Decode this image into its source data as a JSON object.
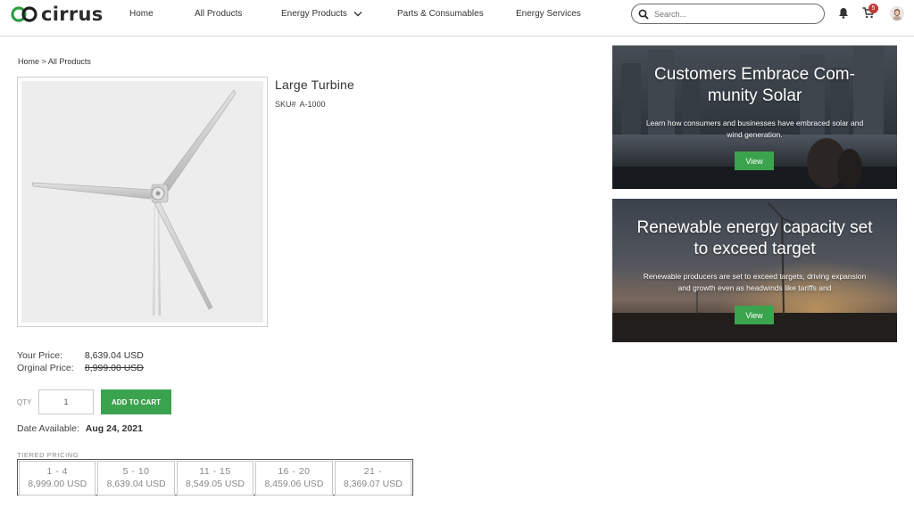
{
  "brand": {
    "name": "cirrus",
    "color": "#2e9e45"
  },
  "nav": {
    "items": [
      {
        "label": "Home"
      },
      {
        "label": "All Products"
      },
      {
        "label": "Energy Products"
      },
      {
        "label": "Parts & Consumables"
      },
      {
        "label": "Energy Services"
      }
    ],
    "search_placeholder": "Search...",
    "cart_count": "5"
  },
  "breadcrumb": {
    "home": "Home",
    "separator": ">",
    "current": "All Products"
  },
  "product": {
    "title": "Large Turbine",
    "sku_label": "SKU#",
    "sku": "A-1000",
    "your_price_label": "Your Price:",
    "your_price": "8,639.04 USD",
    "original_price_label": "Orginal Price:",
    "original_price": "8,999.00 USD",
    "qty_label": "QTY",
    "qty_value": "1",
    "add_to_cart": "ADD TO CART",
    "date_label": "Date Available:",
    "date_value": "Aug 24, 2021",
    "tier_title": "TIERED PRICING",
    "tiers": [
      {
        "range": "1 - 4",
        "price": "8,999.00 USD"
      },
      {
        "range": "5 - 10",
        "price": "8,639.04 USD"
      },
      {
        "range": "11 - 15",
        "price": "8,549.05 USD"
      },
      {
        "range": "16 - 20",
        "price": "8,459.06 USD"
      },
      {
        "range": "21 -",
        "price": "8,369.07 USD"
      }
    ]
  },
  "promos": [
    {
      "title": "Customers Embrace Com-munity Solar",
      "description": "Learn how consumers and businesses have embraced solar and wind generation.",
      "button": "View"
    },
    {
      "title": "Renewable energy capacity set to exceed target",
      "description": "Renewable producers are set to exceed targets, driving expansion and growth even as headwinds like tariffs and",
      "button": "View"
    }
  ],
  "colors": {
    "accent_green": "#3ba34e",
    "badge_red": "#c23934"
  }
}
